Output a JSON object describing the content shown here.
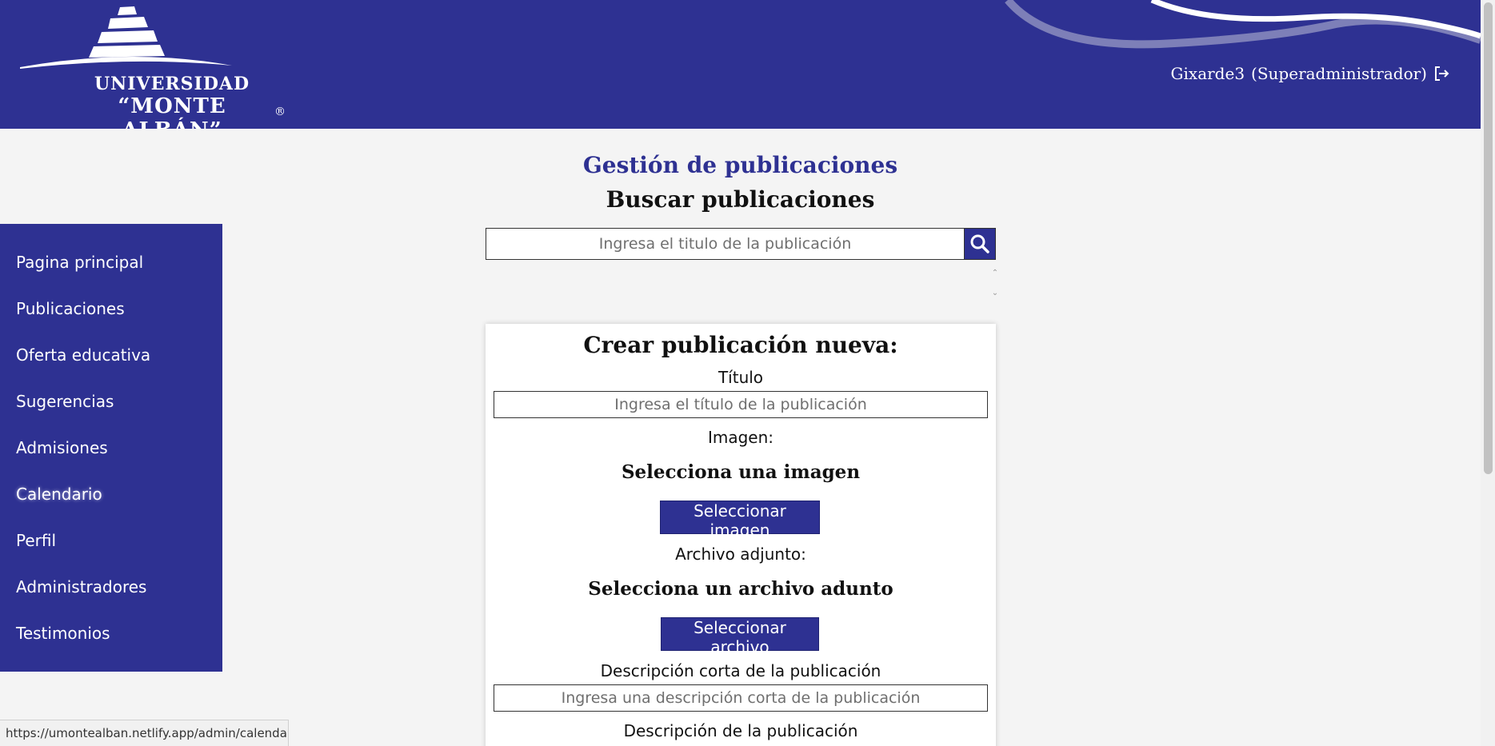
{
  "header": {
    "logo": {
      "line1": "UNIVERSIDAD",
      "line2": "“MONTE ALBÁN”",
      "registered": "®"
    },
    "user": {
      "username": "Gixarde3",
      "role": "(Superadministrador)"
    },
    "bg_color": "#2e3192"
  },
  "sidebar": {
    "items": [
      {
        "label": "Pagina principal"
      },
      {
        "label": "Publicaciones"
      },
      {
        "label": "Oferta educativa"
      },
      {
        "label": "Sugerencias"
      },
      {
        "label": "Admisiones"
      },
      {
        "label": "Calendario"
      },
      {
        "label": "Perfil"
      },
      {
        "label": "Administradores"
      },
      {
        "label": "Testimonios"
      }
    ]
  },
  "main": {
    "heading": "Gestión de publicaciones",
    "subheading": "Buscar publicaciones",
    "search": {
      "placeholder": "Ingresa el titulo de la publicación",
      "icon": "search-icon"
    }
  },
  "form": {
    "title": "Crear publicación nueva:",
    "title_label": "Título",
    "title_placeholder": "Ingresa el título de la publicación",
    "image_label": "Imagen:",
    "image_prompt": "Selecciona una imagen",
    "image_button": "Seleccionar imagen",
    "file_label": "Archivo adjunto:",
    "file_prompt": "Selecciona un archivo adunto",
    "file_button": "Seleccionar archivo",
    "short_desc_label": "Descripción corta de la publicación",
    "short_desc_placeholder": "Ingresa una descripción corta de la publicación",
    "desc_label": "Descripción de la publicación"
  },
  "status_bar": {
    "url": "https://umontealban.netlify.app/admin/calendar"
  },
  "colors": {
    "primary": "#2e3192",
    "background": "#f4f4f4"
  }
}
